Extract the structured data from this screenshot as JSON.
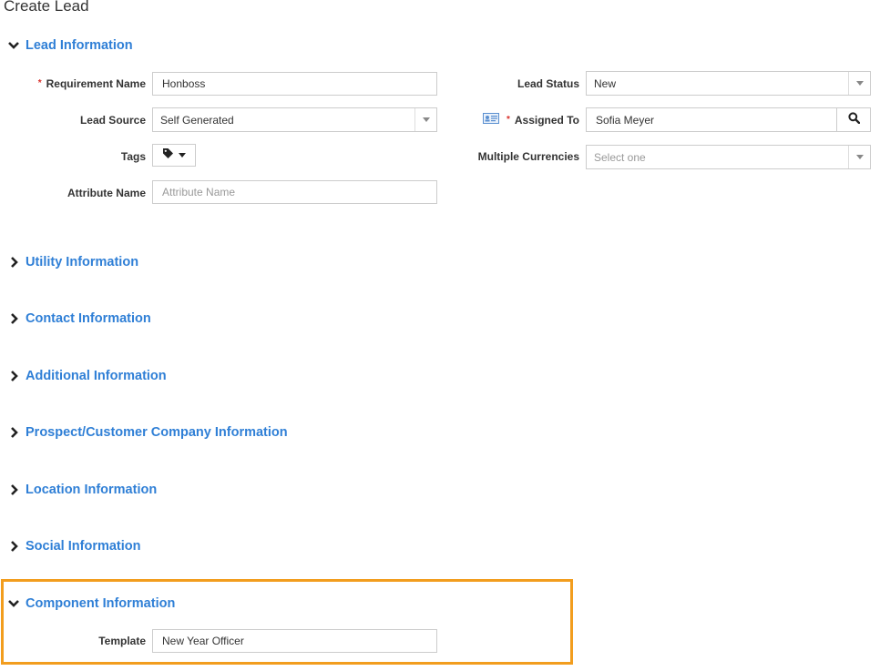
{
  "page": {
    "title": "Create Lead"
  },
  "sections": {
    "lead_information": "Lead Information",
    "utility_information": "Utility Information",
    "contact_information": "Contact Information",
    "additional_information": "Additional Information",
    "prospect_customer_company_information": "Prospect/Customer Company Information",
    "location_information": "Location Information",
    "social_information": "Social Information",
    "component_information": "Component Information"
  },
  "lead": {
    "requirement_name": {
      "label": "Requirement Name",
      "required_mark": "*",
      "value": "Honboss"
    },
    "lead_source": {
      "label": "Lead Source",
      "value": "Self Generated"
    },
    "tags": {
      "label": "Tags"
    },
    "attribute_name": {
      "label": "Attribute Name",
      "placeholder": "Attribute Name"
    },
    "lead_status": {
      "label": "Lead Status",
      "value": "New"
    },
    "assigned_to": {
      "label": "Assigned To",
      "required_mark": "*",
      "value": "Sofia Meyer"
    },
    "multiple_currencies": {
      "label": "Multiple Currencies",
      "placeholder": "Select one"
    }
  },
  "component": {
    "template": {
      "label": "Template",
      "value": "New Year Officer"
    }
  },
  "colors": {
    "section_title": "#2f7fd6",
    "highlight_border": "#f29d1e",
    "required": "#d9302b"
  },
  "icons": {
    "expanded": "chevron-down-icon",
    "collapsed": "chevron-right-icon",
    "tag": "tag-icon",
    "search": "search-icon",
    "contact_card": "contact-card-icon"
  }
}
